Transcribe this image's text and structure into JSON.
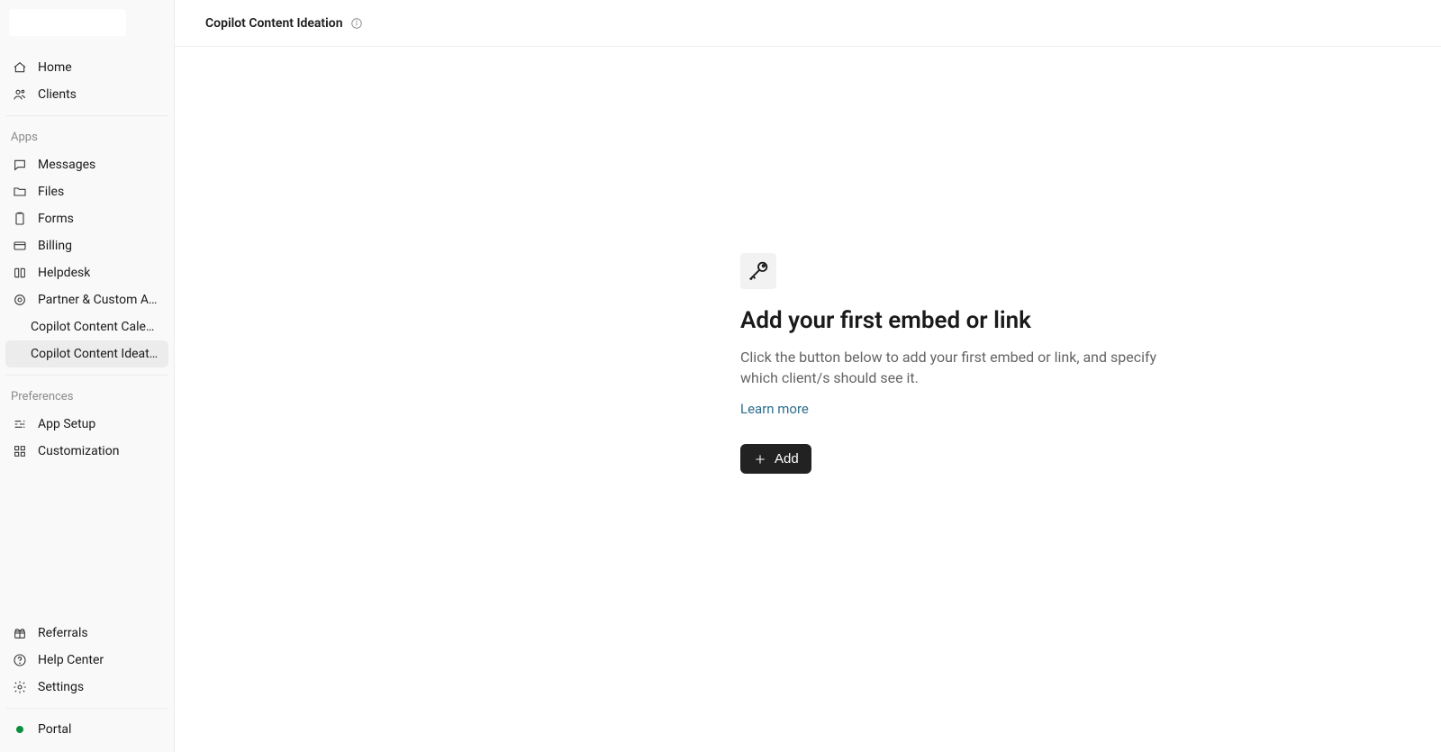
{
  "header": {
    "title": "Copilot Content Ideation"
  },
  "sidebar": {
    "main": [
      {
        "label": "Home"
      },
      {
        "label": "Clients"
      }
    ],
    "apps_heading": "Apps",
    "apps": [
      {
        "label": "Messages"
      },
      {
        "label": "Files"
      },
      {
        "label": "Forms"
      },
      {
        "label": "Billing"
      },
      {
        "label": "Helpdesk"
      },
      {
        "label": "Partner & Custom Apps"
      }
    ],
    "custom_apps": [
      {
        "label": "Copilot Content Cale…"
      },
      {
        "label": "Copilot Content Ideat…"
      }
    ],
    "prefs_heading": "Preferences",
    "prefs": [
      {
        "label": "App Setup"
      },
      {
        "label": "Customization"
      }
    ],
    "footer": [
      {
        "label": "Referrals"
      },
      {
        "label": "Help Center"
      },
      {
        "label": "Settings"
      }
    ],
    "portal_label": "Portal"
  },
  "empty": {
    "title": "Add your first embed or link",
    "desc": "Click the button below to add your first embed or link, and specify which client/s should see it.",
    "learn_more": "Learn more",
    "add_label": "Add"
  }
}
